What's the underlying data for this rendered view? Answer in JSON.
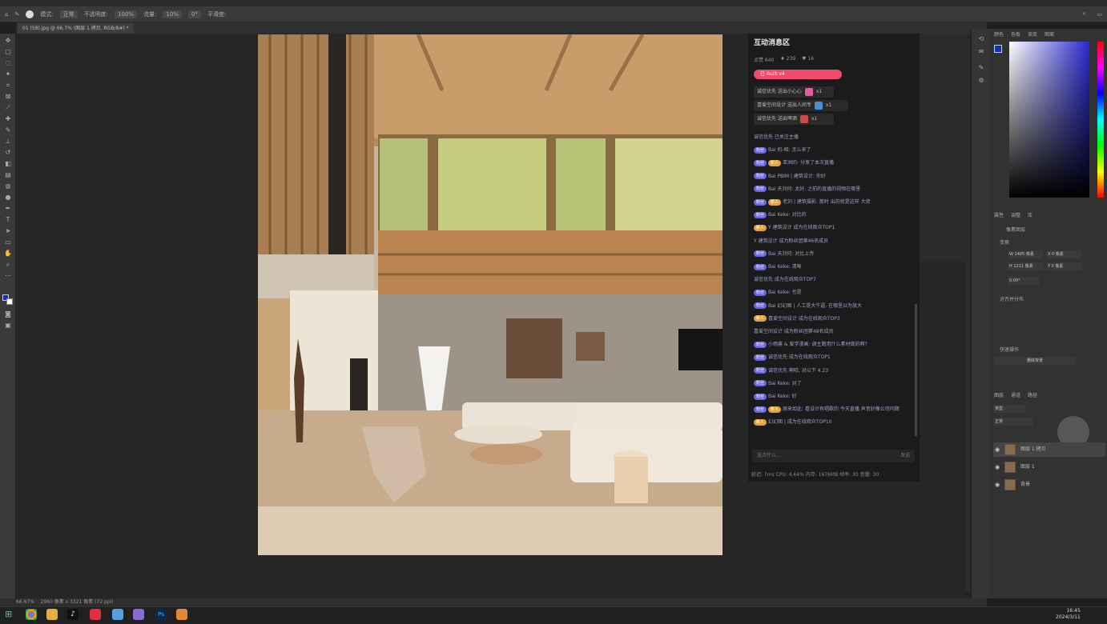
{
  "window": {
    "doc_tab": "01 (58).jpg @ 66.7% (图层 1 拷贝, RGB/8#) *",
    "status_zoom": "66.67%",
    "status_info": "2960 像素 x 3321 像素 (72 ppi)"
  },
  "options_bar": {
    "mode_label": "模式:",
    "mode_value": "正常",
    "opacity_label": "不透明度:",
    "opacity_value": "100%",
    "flow_label": "流量:",
    "flow_value": "10%",
    "angle_value": "0°",
    "smoothing_label": "平滑度:"
  },
  "chat": {
    "title": "互动消息区",
    "stats": [
      "点赞 640",
      "♦ 239",
      "♥ 16"
    ],
    "banner": "已 Built v4",
    "gifts": [
      {
        "text": "诚信优先 送出小心心",
        "count": "x1",
        "color": "#e85a9a"
      },
      {
        "text": "喜爱空间设计 送出人间专",
        "count": "x1",
        "color": "#4a90d0"
      },
      {
        "text": "诚信优先 送出啤酒",
        "count": "x1",
        "color": "#d04a4a"
      }
    ],
    "messages": [
      {
        "badge": "",
        "gold": "",
        "text": "诚信优先 已关注主播"
      },
      {
        "badge": "粉丝",
        "gold": "",
        "text": "Bai 机-相: 怎么来了"
      },
      {
        "badge": "粉丝",
        "gold": "新人",
        "text": "亚洲的: 分享了本次直播"
      },
      {
        "badge": "粉丝",
        "gold": "",
        "text": "Bai PBIM | 建筑设计: 你好"
      },
      {
        "badge": "粉丝",
        "gold": "",
        "text": "Bai 天刘何: 太好, 之前的直播的视频在哪里"
      },
      {
        "badge": "粉丝",
        "gold": "新人",
        "text": "老刘 | 建筑摄影: 那时 出的就是这样 大佬"
      },
      {
        "badge": "粉丝",
        "gold": "",
        "text": "Bai Keke: 对比的"
      },
      {
        "badge": "",
        "gold": "新人",
        "text": "Y 建筑设计 成为在线观众TOP1"
      },
      {
        "badge": "",
        "gold": "",
        "text": "Y 建筑设计 成为粉丝团第46名成员"
      },
      {
        "badge": "粉丝",
        "gold": "",
        "text": "Bai 天刘何: 对比上传"
      },
      {
        "badge": "粉丝",
        "gold": "",
        "text": "Bai Keke: 清晰"
      },
      {
        "badge": "",
        "gold": "",
        "text": "诚信优先 成为在线观众TOP7"
      },
      {
        "badge": "粉丝",
        "gold": "",
        "text": "Bai Keke: 也是"
      },
      {
        "badge": "粉丝",
        "gold": "",
        "text": "Bai 幻幻图 | 人工是大牛逼, 在哪里以为放大"
      },
      {
        "badge": "",
        "gold": "新人",
        "text": "喜爱空间设计 成为在线观众TOP3"
      },
      {
        "badge": "",
        "gold": "",
        "text": "喜爱空间设计 成为粉丝团第48名成员"
      },
      {
        "badge": "粉丝",
        "gold": "",
        "text": "小雨酱 & 爱学漫画: 调主题用什么素材做的啊?"
      },
      {
        "badge": "粉丝",
        "gold": "",
        "text": "诚信优先 成为在线观众TOP1"
      },
      {
        "badge": "粉丝",
        "gold": "",
        "text": "诚信优先 啊哈, 对以下 4.23"
      },
      {
        "badge": "粉丝",
        "gold": "",
        "text": "Bai Keke: 对了"
      },
      {
        "badge": "粉丝",
        "gold": "",
        "text": "Bai Keke: 好"
      },
      {
        "badge": "粉丝",
        "gold": "新人",
        "text": "原来如此: 看设计有唱歌的 今天直播 声音好像公司问题"
      },
      {
        "badge": "",
        "gold": "新人",
        "text": "幻幻图 | 成为在线观众TOP10"
      }
    ],
    "input_placeholder": "说点什么...",
    "send_label": "发送",
    "footer": "延迟: 7ms    CPU: 4.64%    内存: 1676MB    帧率: 30    音量: 30"
  },
  "right_panel": {
    "color_tabs": [
      "颜色",
      "色板",
      "渐变",
      "图案"
    ],
    "props_tabs": [
      "属性",
      "调整",
      "库"
    ],
    "props_title": "像素图层",
    "transform_label": "变换",
    "w_value": "W 1405 像素",
    "h_value": "H 1211 像素",
    "x_value": "X 0 像素",
    "y_value": "Y 0 像素",
    "angle_value": "0.00°",
    "align_label": "对齐并分布",
    "quick_label": "快速操作",
    "quick_button": "删除背景",
    "layers_tabs": [
      "图层",
      "通道",
      "路径"
    ],
    "kind_label": "类型",
    "blend_mode": "正常",
    "layers": [
      {
        "name": "图层 1 拷贝"
      },
      {
        "name": "图层 1"
      },
      {
        "name": "背景"
      }
    ]
  },
  "taskbar": {
    "time": "16:45",
    "date": "2024/3/11"
  }
}
